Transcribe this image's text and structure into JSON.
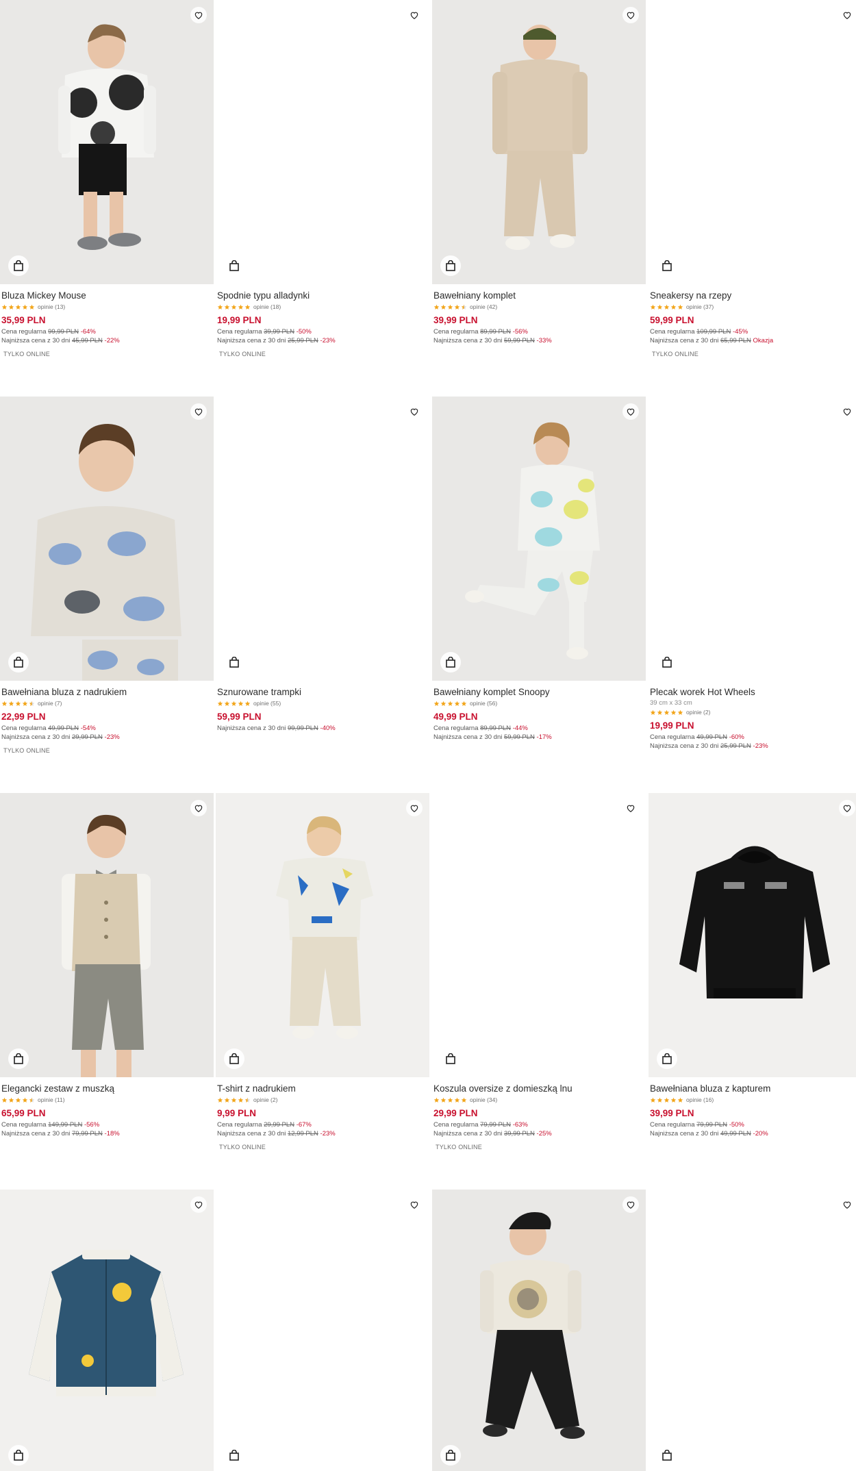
{
  "products": [
    {
      "name": "Bluza Mickey Mouse",
      "reviews": "opinie (13)",
      "stars": 5,
      "price": "35,99 PLN",
      "regular_label": "Cena regularna",
      "regular_price": "99,99 PLN",
      "regular_pct": "-64%",
      "lowest_label": "Najniższa cena z 30 dni",
      "lowest_price": "45,99 PLN",
      "lowest_pct": "-22%",
      "badge": "TYLKO ONLINE",
      "image": "boy-mickey-hoodie"
    },
    {
      "name": "Spodnie typu alladynki",
      "reviews": "opinie (18)",
      "stars": 5,
      "price": "19,99 PLN",
      "regular_label": "Cena regularna",
      "regular_price": "39,99 PLN",
      "regular_pct": "-50%",
      "lowest_label": "Najniższa cena z 30 dni",
      "lowest_price": "25,99 PLN",
      "lowest_pct": "-23%",
      "badge": "TYLKO ONLINE",
      "image": "blank"
    },
    {
      "name": "Bawełniany komplet",
      "reviews": "opinie (42)",
      "stars": 4.5,
      "price": "39,99 PLN",
      "regular_label": "Cena regularna",
      "regular_price": "89,99 PLN",
      "regular_pct": "-56%",
      "lowest_label": "Najniższa cena z 30 dni",
      "lowest_price": "59,99 PLN",
      "lowest_pct": "-33%",
      "badge": "",
      "image": "boy-beige-tracksuit"
    },
    {
      "name": "Sneakersy na rzepy",
      "reviews": "opinie (37)",
      "stars": 5,
      "price": "59,99 PLN",
      "regular_label": "Cena regularna",
      "regular_price": "109,99 PLN",
      "regular_pct": "-45%",
      "lowest_label": "Najniższa cena z 30 dni",
      "lowest_price": "65,99 PLN",
      "lowest_pct": "Okazja",
      "badge": "TYLKO ONLINE",
      "image": "blank"
    },
    {
      "name": "Bawełniana bluza z nadrukiem",
      "reviews": "opinie (7)",
      "stars": 4.5,
      "price": "22,99 PLN",
      "regular_label": "Cena regularna",
      "regular_price": "49,99 PLN",
      "regular_pct": "-54%",
      "lowest_label": "Najniższa cena z 30 dni",
      "lowest_price": "29,99 PLN",
      "lowest_pct": "-23%",
      "badge": "TYLKO ONLINE",
      "image": "boy-elephant-sweatshirt"
    },
    {
      "name": "Sznurowane trampki",
      "reviews": "opinie (55)",
      "stars": 5,
      "price": "59,99 PLN",
      "regular_label": "",
      "regular_price": "",
      "regular_pct": "",
      "lowest_label": "Najniższa cena z 30 dni",
      "lowest_price": "99,99 PLN",
      "lowest_pct": "-40%",
      "badge": "",
      "image": "blank"
    },
    {
      "name": "Bawełniany komplet Snoopy",
      "reviews": "opinie (56)",
      "stars": 5,
      "price": "49,99 PLN",
      "regular_label": "Cena regularna",
      "regular_price": "89,99 PLN",
      "regular_pct": "-44%",
      "lowest_label": "Najniższa cena z 30 dni",
      "lowest_price": "59,99 PLN",
      "lowest_pct": "-17%",
      "badge": "",
      "image": "boy-snoopy-set"
    },
    {
      "name": "Plecak worek Hot Wheels",
      "size": "39 cm x 33 cm",
      "reviews": "opinie (2)",
      "stars": 5,
      "price": "19,99 PLN",
      "regular_label": "Cena regularna",
      "regular_price": "49,99 PLN",
      "regular_pct": "-60%",
      "lowest_label": "Najniższa cena z 30 dni",
      "lowest_price": "25,99 PLN",
      "lowest_pct": "-23%",
      "badge": "",
      "image": "blank"
    },
    {
      "name": "Elegancki zestaw z muszką",
      "reviews": "opinie (11)",
      "stars": 4.5,
      "price": "65,99 PLN",
      "regular_label": "Cena regularna",
      "regular_price": "149,99 PLN",
      "regular_pct": "-56%",
      "lowest_label": "Najniższa cena z 30 dni",
      "lowest_price": "79,99 PLN",
      "lowest_pct": "-18%",
      "badge": "",
      "image": "boy-vest-bowtie"
    },
    {
      "name": "T-shirt z nadrukiem",
      "reviews": "opinie (2)",
      "stars": 4.5,
      "price": "9,99 PLN",
      "regular_label": "Cena regularna",
      "regular_price": "29,99 PLN",
      "regular_pct": "-67%",
      "lowest_label": "Najniższa cena z 30 dni",
      "lowest_price": "12,99 PLN",
      "lowest_pct": "-23%",
      "badge": "TYLKO ONLINE",
      "image": "boy-printed-tshirt"
    },
    {
      "name": "Koszula oversize z domieszką lnu",
      "reviews": "opinie (34)",
      "stars": 5,
      "price": "29,99 PLN",
      "regular_label": "Cena regularna",
      "regular_price": "79,99 PLN",
      "regular_pct": "-63%",
      "lowest_label": "Najniższa cena z 30 dni",
      "lowest_price": "39,99 PLN",
      "lowest_pct": "-25%",
      "badge": "TYLKO ONLINE",
      "image": "blank"
    },
    {
      "name": "Bawełniana bluza z kapturem",
      "reviews": "opinie (16)",
      "stars": 5,
      "price": "39,99 PLN",
      "regular_label": "Cena regularna",
      "regular_price": "79,99 PLN",
      "regular_pct": "-50%",
      "lowest_label": "Najniższa cena z 30 dni",
      "lowest_price": "49,99 PLN",
      "lowest_pct": "-20%",
      "badge": "",
      "image": "black-hoodie"
    },
    {
      "name": "",
      "image": "varsity-jacket"
    },
    {
      "name": "",
      "image": "blank"
    },
    {
      "name": "",
      "image": "boy-cap-sweatshirt"
    },
    {
      "name": "",
      "image": "blank"
    }
  ],
  "colors": {
    "price": "#c8102e",
    "star": "#f2a51a",
    "text": "#2b2b2b"
  },
  "icons": {
    "favorite": "heart-icon",
    "cart": "shopping-bag-icon"
  }
}
